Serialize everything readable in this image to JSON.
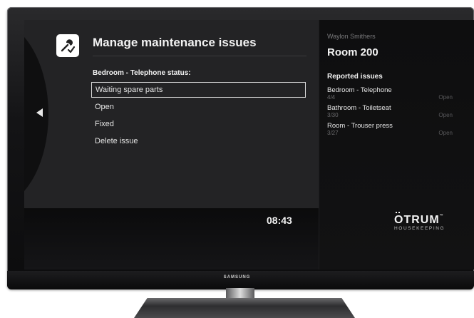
{
  "screen": {
    "title": "Manage maintenance issues",
    "section_label": "Bedroom - Telephone status:",
    "options": [
      {
        "label": "Waiting spare parts",
        "selected": true
      },
      {
        "label": "Open",
        "selected": false
      },
      {
        "label": "Fixed",
        "selected": false
      },
      {
        "label": "Delete issue",
        "selected": false
      }
    ],
    "clock": "08:43"
  },
  "panel": {
    "guest_name": "Waylon Smithers",
    "room": "Room 200",
    "reported_heading": "Reported issues",
    "issues": [
      {
        "name": "Bedroom - Telephone",
        "date": "4/4",
        "status": "Open"
      },
      {
        "name": "Bathroom - Toiletseat",
        "date": "3/30",
        "status": "Open"
      },
      {
        "name": "Room - Trouser press",
        "date": "3/27",
        "status": "Open"
      }
    ],
    "logo": {
      "name": "OTRUM",
      "tm": "™",
      "subtitle": "HOUSEKEEPING"
    }
  },
  "tv": {
    "brand": "SAMSUNG"
  },
  "icons": {
    "header": "wrench-check-icon",
    "nav": "arrow-left-icon"
  },
  "colors": {
    "screen_bg": "#232325",
    "panel_bg": "#0e0e0f",
    "text": "#f2f2f2",
    "muted": "#6a6a6c"
  }
}
